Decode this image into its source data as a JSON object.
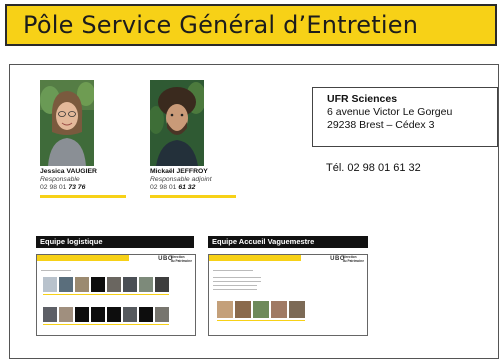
{
  "header": {
    "title": "Pôle Service Général d’Entretien"
  },
  "people": [
    {
      "name": "Jessica VAUGIER",
      "role": "Responsable",
      "phone_prefix": "02 98 01 ",
      "phone_suffix": "73 76"
    },
    {
      "name": "Mickaël JEFFROY",
      "role": "Responsable adjoint",
      "phone_prefix": "02 98 01 ",
      "phone_suffix": "61 32"
    }
  ],
  "address": {
    "title": "UFR Sciences",
    "street": "6 avenue Victor Le Gorgeu",
    "city": "29238 Brest – Cédex 3"
  },
  "telephone": "Tél. 02 98 01 61 32",
  "teams": [
    {
      "label": "Equipe logistique"
    },
    {
      "label": "Equipe Accueil Vaguemestre"
    }
  ],
  "slide": {
    "logo": "UBO",
    "logo_caption_1": "Direction",
    "logo_caption_2": "du Patrimoine"
  },
  "colors": {
    "accent": "#f7d117",
    "frame": "#555555"
  }
}
